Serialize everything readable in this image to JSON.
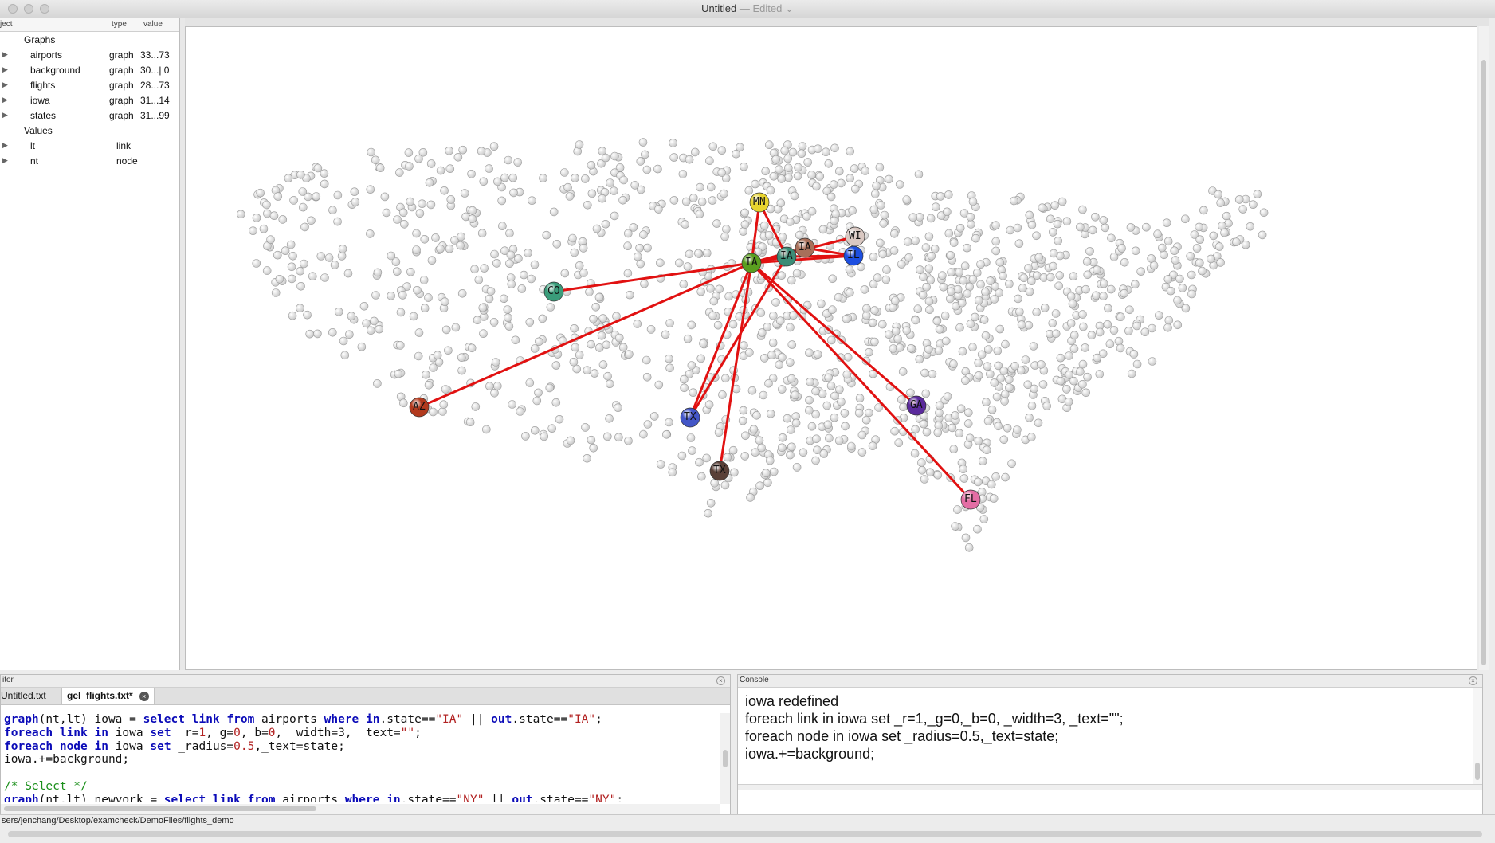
{
  "window": {
    "title": "Untitled",
    "separator": "—",
    "status": "Edited",
    "status_chevron": "⌄"
  },
  "object_panel": {
    "columns": [
      "ject",
      "type",
      "value"
    ],
    "rows": [
      {
        "label": "Graphs",
        "type": "",
        "value": "",
        "level": 0,
        "expandable": false
      },
      {
        "label": "airports",
        "type": "graph",
        "value": "33...73",
        "level": 1,
        "expandable": true
      },
      {
        "label": "background",
        "type": "graph",
        "value": "30...| 0",
        "level": 1,
        "expandable": true
      },
      {
        "label": "flights",
        "type": "graph",
        "value": "28...73",
        "level": 1,
        "expandable": true
      },
      {
        "label": "iowa",
        "type": "graph",
        "value": "31...14",
        "level": 1,
        "expandable": true
      },
      {
        "label": "states",
        "type": "graph",
        "value": "31...99",
        "level": 1,
        "expandable": true
      },
      {
        "label": "Values",
        "type": "",
        "value": "",
        "level": 0,
        "expandable": false
      },
      {
        "label": "lt",
        "type": "link",
        "value": "",
        "level": 1,
        "expandable": true
      },
      {
        "label": "nt",
        "type": "node",
        "value": "",
        "level": 1,
        "expandable": true
      }
    ]
  },
  "graph": {
    "background_node_color": "#c6c6c6",
    "edge_color": "#e11111",
    "hub": "IA",
    "nodes": [
      {
        "id": "IA",
        "label": "IA",
        "color": "#5a9e1f"
      },
      {
        "id": "MN",
        "label": "MN",
        "color": "#e8d42e"
      },
      {
        "id": "IA2",
        "label": "IA",
        "color": "#3c8c76"
      },
      {
        "id": "IA3",
        "label": "IA",
        "color": "#a8705a"
      },
      {
        "id": "WI",
        "label": "WI",
        "color": "#d9c8c2"
      },
      {
        "id": "IL",
        "label": "IL",
        "color": "#1d4fe0"
      },
      {
        "id": "CO",
        "label": "CO",
        "color": "#3a9c7a"
      },
      {
        "id": "AZ",
        "label": "AZ",
        "color": "#b23a1e"
      },
      {
        "id": "TX1",
        "label": "TX",
        "color": "#4356c7"
      },
      {
        "id": "TX2",
        "label": "TX",
        "color": "#5a4038"
      },
      {
        "id": "GA",
        "label": "GA",
        "color": "#5b2a9c"
      },
      {
        "id": "FL",
        "label": "FL",
        "color": "#e46ea5"
      }
    ],
    "edges": [
      [
        "IA",
        "MN"
      ],
      [
        "IA",
        "IA2"
      ],
      [
        "IA",
        "IA3"
      ],
      [
        "IA",
        "WI"
      ],
      [
        "IA",
        "IL"
      ],
      [
        "IA",
        "CO"
      ],
      [
        "IA",
        "AZ"
      ],
      [
        "IA",
        "TX1"
      ],
      [
        "IA",
        "TX2"
      ],
      [
        "IA",
        "GA"
      ],
      [
        "IA",
        "FL"
      ],
      [
        "MN",
        "IA2"
      ],
      [
        "IA2",
        "IL"
      ],
      [
        "IA3",
        "IL"
      ],
      [
        "IA2",
        "TX1"
      ]
    ]
  },
  "editor": {
    "title": "itor",
    "tabs": [
      {
        "label": "Untitled.txt",
        "active": false
      },
      {
        "label": "gel_flights.txt*",
        "active": true
      }
    ],
    "close_glyph": "×",
    "lines": [
      [
        [
          "kw",
          "graph"
        ],
        [
          "t",
          "(nt,lt) iowa = "
        ],
        [
          "kw",
          "select"
        ],
        [
          "t",
          " "
        ],
        [
          "kw",
          "link"
        ],
        [
          "t",
          " "
        ],
        [
          "kw",
          "from"
        ],
        [
          "t",
          " airports "
        ],
        [
          "kw",
          "where"
        ],
        [
          "t",
          " "
        ],
        [
          "kw",
          "in"
        ],
        [
          "t",
          ".state=="
        ],
        [
          "str",
          "\"IA\""
        ],
        [
          "t",
          " || "
        ],
        [
          "kw",
          "out"
        ],
        [
          "t",
          ".state=="
        ],
        [
          "str",
          "\"IA\""
        ],
        [
          "t",
          ";"
        ]
      ],
      [
        [
          "kw",
          "foreach"
        ],
        [
          "t",
          " "
        ],
        [
          "kw",
          "link"
        ],
        [
          "t",
          " "
        ],
        [
          "kw",
          "in"
        ],
        [
          "t",
          " iowa "
        ],
        [
          "kw",
          "set"
        ],
        [
          "t",
          " _r="
        ],
        [
          "num",
          "1"
        ],
        [
          "t",
          ",_g="
        ],
        [
          "num",
          "0"
        ],
        [
          "t",
          ",_b="
        ],
        [
          "num",
          "0"
        ],
        [
          "t",
          ", _width=3, _text="
        ],
        [
          "str",
          "\"\""
        ],
        [
          "t",
          ";"
        ]
      ],
      [
        [
          "kw",
          "foreach"
        ],
        [
          "t",
          " "
        ],
        [
          "kw",
          "node"
        ],
        [
          "t",
          " "
        ],
        [
          "kw",
          "in"
        ],
        [
          "t",
          " iowa "
        ],
        [
          "kw",
          "set"
        ],
        [
          "t",
          " _radius="
        ],
        [
          "num",
          "0.5"
        ],
        [
          "t",
          ",_text=state;"
        ]
      ],
      [
        [
          "t",
          "iowa.+=background;"
        ]
      ],
      [
        [
          "t",
          ""
        ]
      ],
      [
        [
          "cmt",
          "/* Select */"
        ]
      ],
      [
        [
          "kw",
          "graph"
        ],
        [
          "t",
          "(nt,lt) newyork = "
        ],
        [
          "kw",
          "select"
        ],
        [
          "t",
          " "
        ],
        [
          "kw",
          "link"
        ],
        [
          "t",
          " "
        ],
        [
          "kw",
          "from"
        ],
        [
          "t",
          " airports "
        ],
        [
          "kw",
          "where"
        ],
        [
          "t",
          " "
        ],
        [
          "kw",
          "in"
        ],
        [
          "t",
          ".state=="
        ],
        [
          "str",
          "\"NY\""
        ],
        [
          "t",
          " || "
        ],
        [
          "kw",
          "out"
        ],
        [
          "t",
          ".state=="
        ],
        [
          "str",
          "\"NY\""
        ],
        [
          "t",
          ";"
        ]
      ]
    ]
  },
  "console": {
    "title": "Console",
    "close_glyph": "×",
    "output": [
      "iowa redefined",
      "foreach link in iowa set _r=1,_g=0,_b=0, _width=3, _text=\"\";",
      "foreach node in iowa set _radius=0.5,_text=state;",
      "iowa.+=background;"
    ],
    "input_value": ""
  },
  "status": {
    "path": "sers/jenchang/Desktop/examcheck/DemoFiles/flights_demo"
  }
}
